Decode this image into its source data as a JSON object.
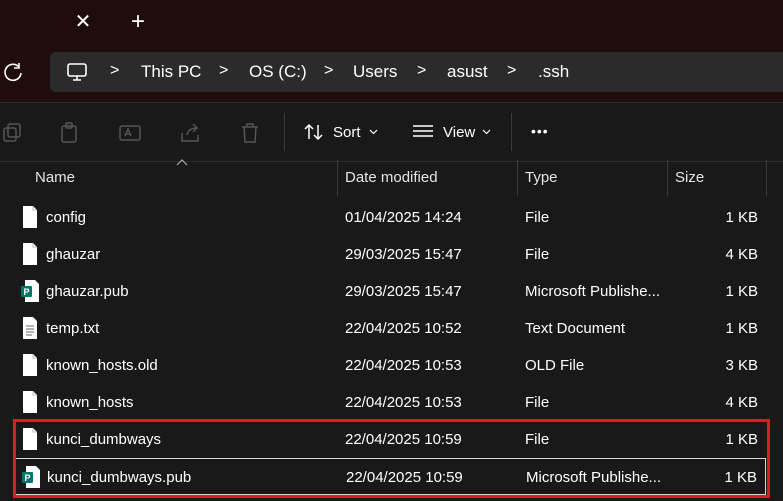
{
  "tabbar": {
    "close_glyph": "✕",
    "new_glyph": "+"
  },
  "address": {
    "items": [
      "This PC",
      "OS (C:)",
      "Users",
      "asust",
      ".ssh"
    ],
    "separator": ">"
  },
  "toolbar": {
    "sort_label": "Sort",
    "view_label": "View",
    "more_label": "•••"
  },
  "columns": {
    "name": "Name",
    "date": "Date modified",
    "type": "Type",
    "size": "Size"
  },
  "files": [
    {
      "name": "config",
      "date": "01/04/2025 14:24",
      "type": "File",
      "size": "1 KB",
      "icon": "blank-file-icon"
    },
    {
      "name": "ghauzar",
      "date": "29/03/2025 15:47",
      "type": "File",
      "size": "4 KB",
      "icon": "blank-file-icon"
    },
    {
      "name": "ghauzar.pub",
      "date": "29/03/2025 15:47",
      "type": "Microsoft Publishe...",
      "size": "1 KB",
      "icon": "publisher-file-icon"
    },
    {
      "name": "temp.txt",
      "date": "22/04/2025 10:52",
      "type": "Text Document",
      "size": "1 KB",
      "icon": "text-file-icon"
    },
    {
      "name": "known_hosts.old",
      "date": "22/04/2025 10:53",
      "type": "OLD File",
      "size": "3 KB",
      "icon": "blank-file-icon"
    },
    {
      "name": "known_hosts",
      "date": "22/04/2025 10:53",
      "type": "File",
      "size": "4 KB",
      "icon": "blank-file-icon"
    },
    {
      "name": "kunci_dumbways",
      "date": "22/04/2025 10:59",
      "type": "File",
      "size": "1 KB",
      "icon": "blank-file-icon"
    },
    {
      "name": "kunci_dumbways.pub",
      "date": "22/04/2025 10:59",
      "type": "Microsoft Publishe...",
      "size": "1 KB",
      "icon": "publisher-file-icon"
    }
  ],
  "selected_row": 7,
  "colors": {
    "highlight": "#e01b24",
    "publisher": "#077568",
    "background": "#191919"
  }
}
